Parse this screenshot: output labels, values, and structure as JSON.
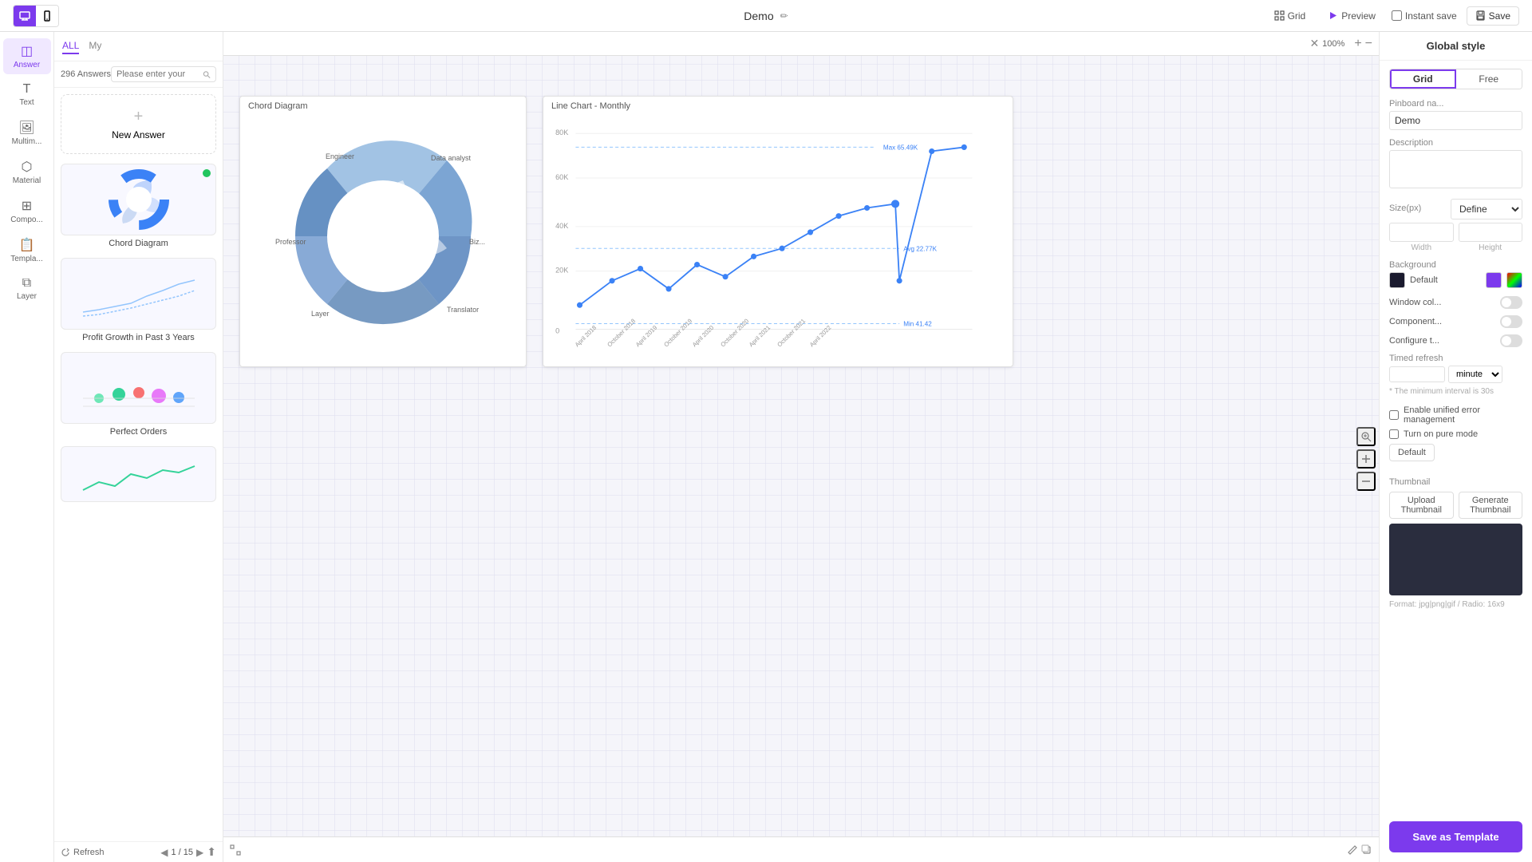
{
  "topbar": {
    "title": "Demo",
    "edit_label": "✏",
    "grid_label": "Grid",
    "preview_label": "Preview",
    "instant_save_label": "Instant save",
    "save_label": "Save",
    "view_desktop": "🖥",
    "view_mobile": "📱"
  },
  "sidebar": {
    "items": [
      {
        "label": "Answer",
        "icon": "◫"
      },
      {
        "label": "Text",
        "icon": "T"
      },
      {
        "label": "Multim...",
        "icon": "🖼"
      },
      {
        "label": "Material",
        "icon": "⬡"
      },
      {
        "label": "Compo...",
        "icon": "⊞"
      },
      {
        "label": "Templa...",
        "icon": "📋"
      },
      {
        "label": "Layer",
        "icon": "⧉"
      }
    ]
  },
  "answer_panel": {
    "tabs": [
      {
        "label": "ALL"
      },
      {
        "label": "My"
      }
    ],
    "count": "296 Answers",
    "search_placeholder": "Please enter your",
    "new_answer_label": "New Answer",
    "cards": [
      {
        "label": "Chord Diagram",
        "has_dot": true
      },
      {
        "label": "Profit Growth in Past 3 Years"
      },
      {
        "label": "Perfect Orders"
      },
      {
        "label": ""
      }
    ]
  },
  "canvas": {
    "zoom": "100%",
    "page_current": "1",
    "page_total": "15",
    "charts": [
      {
        "title": "Chord Diagram",
        "type": "chord"
      },
      {
        "title": "Line Chart - Monthly",
        "type": "line"
      }
    ]
  },
  "right_panel": {
    "title": "Global style",
    "layout_options": [
      {
        "label": "Grid"
      },
      {
        "label": "Free"
      }
    ],
    "pinboard_name_label": "Pinboard na...",
    "pinboard_name_value": "Demo",
    "description_label": "Description",
    "description_value": "",
    "size_label": "Size(px)",
    "size_option": "Define",
    "width_label": "Width",
    "height_label": "Height",
    "background_label": "Background",
    "bg_default_label": "Default",
    "window_col_label": "Window col...",
    "component_label": "Component...",
    "configure_label": "Configure t...",
    "timed_refresh_label": "Timed refresh",
    "timed_refresh_unit": "minute",
    "timed_refresh_hint": "* The minimum interval is 30s",
    "unified_error_label": "Enable unified error management",
    "pure_mode_label": "Turn on pure mode",
    "default_btn_label": "Default",
    "thumbnail_label": "Thumbnail",
    "upload_btn": "Upload Thumbnail",
    "generate_btn": "Generate Thumbnail",
    "thumbnail_format": "Format: jpg|png|gif / Radio: 16x9",
    "save_template_label": "Save as Template"
  }
}
